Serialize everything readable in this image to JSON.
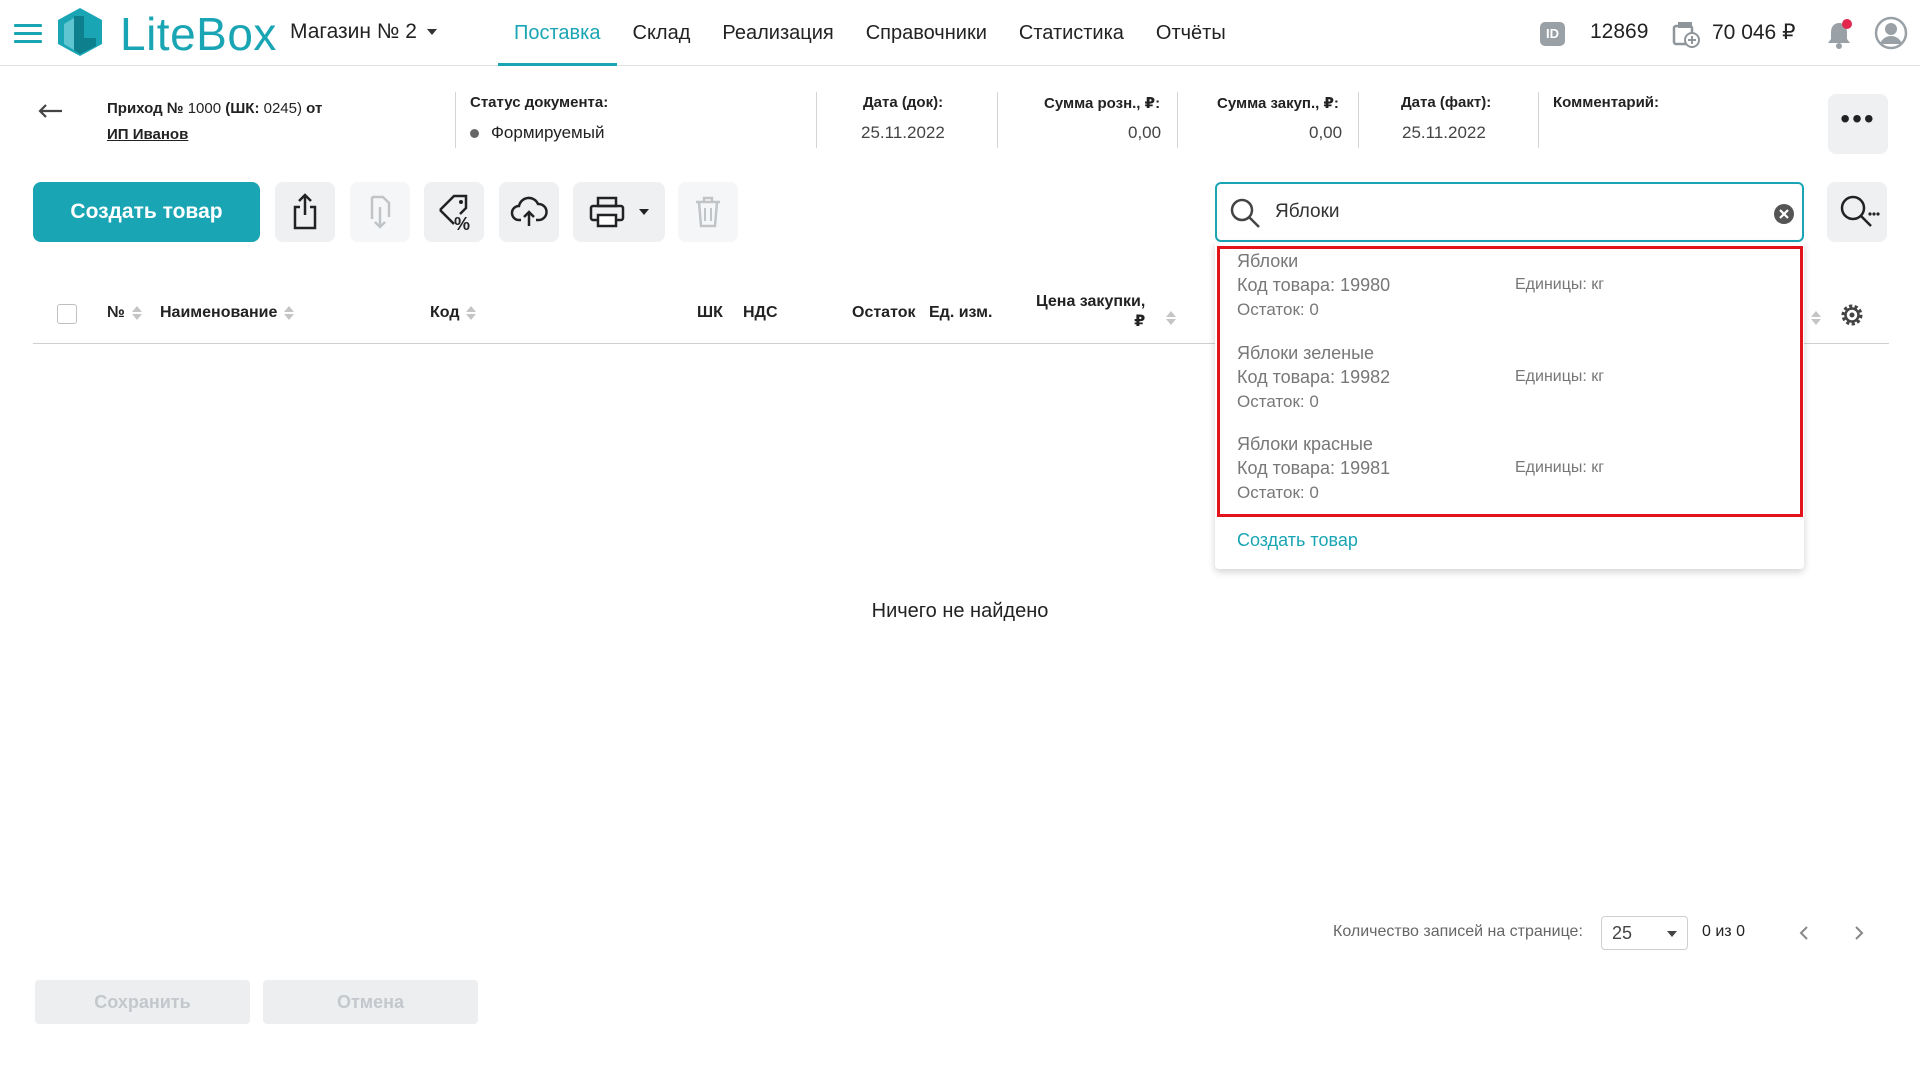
{
  "app": {
    "logo_text": "LiteBox",
    "accent": "#1aa5b4"
  },
  "header": {
    "store": "Магазин № 2",
    "nav": [
      "Поставка",
      "Склад",
      "Реализация",
      "Справочники",
      "Статистика",
      "Отчёты"
    ],
    "id_badge": "ID",
    "user_id": "12869",
    "balance": "70 046 ₽"
  },
  "doc": {
    "title_prefix": "Приход №",
    "number": "1000",
    "barcode_part": "(ШК:",
    "barcode": "0245)",
    "from": "от",
    "org": "ИП Иванов",
    "status_label": "Статус документа:",
    "status_value": "Формируемый",
    "date_doc_label": "Дата (док):",
    "date_doc_value": "25.11.2022",
    "sum_retail_label": "Сумма розн., ₽:",
    "sum_retail_value": "0,00",
    "sum_purchase_label": "Сумма закуп., ₽:",
    "sum_purchase_value": "0,00",
    "date_fact_label": "Дата (факт):",
    "date_fact_value": "25.11.2022",
    "comment_label": "Комментарий:",
    "more": "•••"
  },
  "toolbar": {
    "create_label": "Создать товар"
  },
  "search": {
    "value": "Яблоки",
    "results": [
      {
        "name": "Яблоки",
        "code": "Код товара: 19980",
        "unit": "Единицы: кг",
        "stock": "Остаток: 0"
      },
      {
        "name": "Яблоки зеленые",
        "code": "Код товара: 19982",
        "unit": "Единицы: кг",
        "stock": "Остаток: 0"
      },
      {
        "name": "Яблоки красные",
        "code": "Код товара: 19981",
        "unit": "Единицы: кг",
        "stock": "Остаток: 0"
      }
    ],
    "create_link": "Создать товар"
  },
  "table": {
    "columns": {
      "num": "№",
      "name": "Наименование",
      "code": "Код",
      "barcode": "ШК",
      "vat": "НДС",
      "stock": "Остаток",
      "unit": "Ед. изм.",
      "price_line1": "Цена закупки,",
      "price_line2": "₽"
    },
    "empty_text": "Ничего не найдено"
  },
  "pagination": {
    "label": "Количество записей на странице:",
    "per_page": "25",
    "count": "0 из 0"
  },
  "footer": {
    "save": "Сохранить",
    "cancel": "Отмена"
  }
}
